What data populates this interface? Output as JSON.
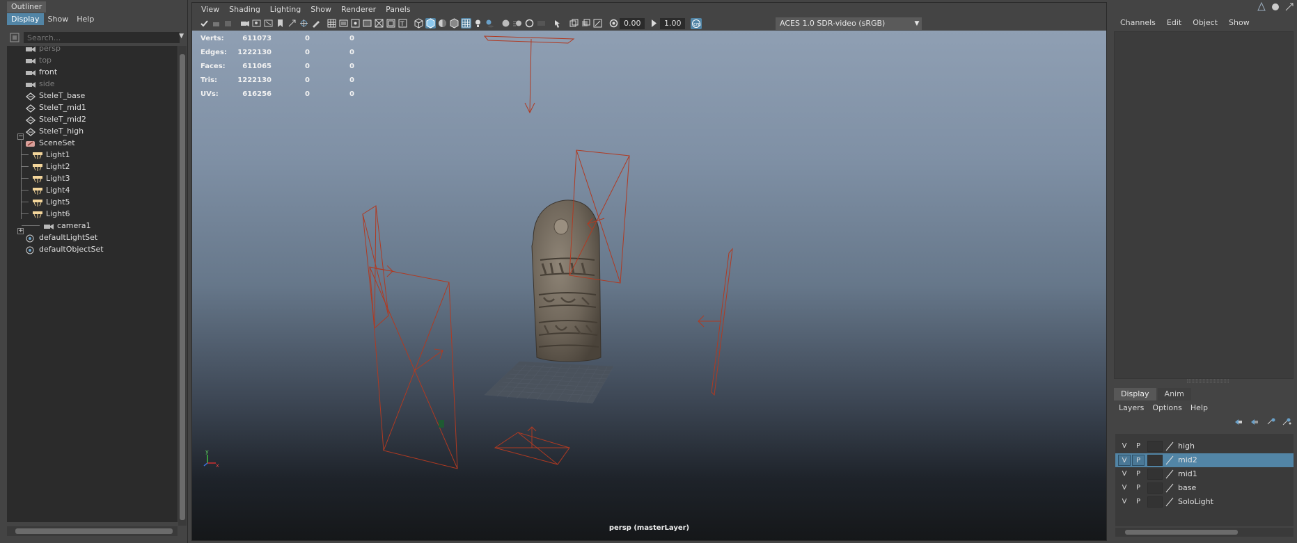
{
  "outliner": {
    "title": "Outliner",
    "menu": [
      "Display",
      "Show",
      "Help"
    ],
    "search_placeholder": "Search...",
    "nodes": [
      {
        "label": "persp",
        "icon": "camera-icon",
        "dim": true
      },
      {
        "label": "top",
        "icon": "camera-icon",
        "dim": true
      },
      {
        "label": "front",
        "icon": "camera-icon",
        "dim": false
      },
      {
        "label": "side",
        "icon": "camera-icon",
        "dim": true
      },
      {
        "label": "SteleT_base",
        "icon": "mesh-transform-icon",
        "dim": false
      },
      {
        "label": "SteleT_mid1",
        "icon": "mesh-transform-icon",
        "dim": false
      },
      {
        "label": "SteleT_mid2",
        "icon": "mesh-transform-icon",
        "dim": false
      },
      {
        "label": "SteleT_high",
        "icon": "mesh-transform-icon",
        "dim": false
      },
      {
        "label": "SceneSet",
        "icon": "set-icon",
        "dim": false
      },
      {
        "label": "Light1",
        "icon": "area-light-icon",
        "dim": false
      },
      {
        "label": "Light2",
        "icon": "area-light-icon",
        "dim": false
      },
      {
        "label": "Light3",
        "icon": "area-light-icon",
        "dim": false
      },
      {
        "label": "Light4",
        "icon": "area-light-icon",
        "dim": false
      },
      {
        "label": "Light5",
        "icon": "area-light-icon",
        "dim": false
      },
      {
        "label": "Light6",
        "icon": "area-light-icon",
        "dim": false
      },
      {
        "label": "camera1",
        "icon": "camera-icon",
        "dim": false
      },
      {
        "label": "defaultLightSet",
        "icon": "object-set-icon",
        "dim": false
      },
      {
        "label": "defaultObjectSet",
        "icon": "object-set-icon",
        "dim": false
      }
    ]
  },
  "viewport": {
    "menu": [
      "View",
      "Shading",
      "Lighting",
      "Show",
      "Renderer",
      "Panels"
    ],
    "exposure": "0.00",
    "gamma": "1.00",
    "color_space": "ACES 1.0 SDR-video (sRGB)",
    "camera_label": "persp (masterLayer)",
    "hud": [
      {
        "label": "Verts:",
        "v1": "611073",
        "v2": "0",
        "v3": "0"
      },
      {
        "label": "Edges:",
        "v1": "1222130",
        "v2": "0",
        "v3": "0"
      },
      {
        "label": "Faces:",
        "v1": "611065",
        "v2": "0",
        "v3": "0"
      },
      {
        "label": "Tris:",
        "v1": "1222130",
        "v2": "0",
        "v3": "0"
      },
      {
        "label": "UVs:",
        "v1": "616256",
        "v2": "0",
        "v3": "0"
      }
    ],
    "axis_labels": {
      "y": "y",
      "x": "x"
    }
  },
  "channel_box": {
    "menu": [
      "Channels",
      "Edit",
      "Object",
      "Show"
    ]
  },
  "layer_editor": {
    "tabs": [
      "Display",
      "Anim"
    ],
    "menu": [
      "Layers",
      "Options",
      "Help"
    ],
    "layers": [
      {
        "v": "V",
        "p": "P",
        "name": "high",
        "selected": false
      },
      {
        "v": "V",
        "p": "P",
        "name": "mid2",
        "selected": true
      },
      {
        "v": "V",
        "p": "P",
        "name": "mid1",
        "selected": false
      },
      {
        "v": "V",
        "p": "P",
        "name": "base",
        "selected": false
      },
      {
        "v": "V",
        "p": "P",
        "name": "SoloLight",
        "selected": false
      }
    ]
  },
  "colors": {
    "accent": "#5285a6",
    "light_wire": "#b03a22",
    "panel_bg": "#444444",
    "field_bg": "#2b2b2b"
  }
}
